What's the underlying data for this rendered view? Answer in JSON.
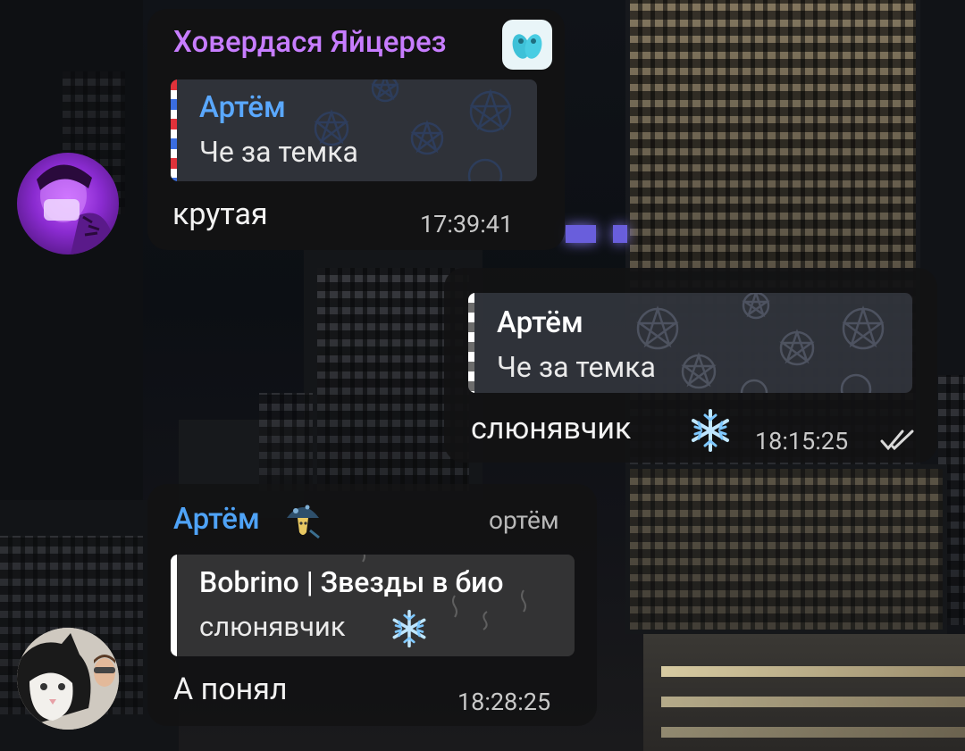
{
  "colors": {
    "bubble_bg": "#121214",
    "sender1_name": "#c77dff",
    "sender2_name": "#4fa3f7",
    "reply_name": "#5aa8ff",
    "reply_bg": "#3a3e48",
    "time": "#c9c9c9",
    "text": "#f2f2f2"
  },
  "messages": [
    {
      "sender": "Ховердася Яйцерез",
      "sender_emoji": "slippers-emoji",
      "avatar": "avatar-purple-masked-person",
      "reply": {
        "name": "Артём",
        "text": "Че за темка"
      },
      "text": "крутая",
      "time": "17:39:41"
    },
    {
      "outgoing": true,
      "reply": {
        "name": "Артём",
        "text": "Че за темка"
      },
      "text": "слюнявчик",
      "text_emoji": "snowflake-emoji",
      "time": "18:15:25",
      "status_icon": "double-check-icon"
    },
    {
      "sender": "Артём",
      "sender_emoji": "mushroom-emoji",
      "admin_title": "ортём",
      "avatar": "avatar-cat-and-boy",
      "reply": {
        "name": "Bobrino | Звезды в био",
        "text": "слюнявчик"
      },
      "reply_emoji": "snowflake-emoji",
      "text": "А понял",
      "time": "18:28:25"
    }
  ]
}
